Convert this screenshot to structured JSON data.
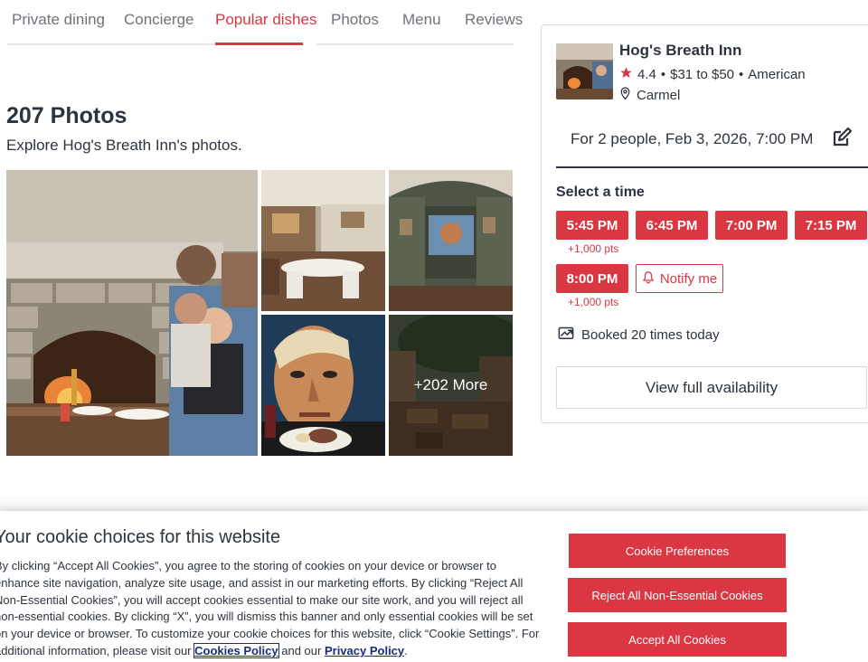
{
  "tabs": [
    {
      "label": "Private dining"
    },
    {
      "label": "Concierge"
    },
    {
      "label": "Popular dishes"
    },
    {
      "label": "Photos"
    },
    {
      "label": "Menu"
    },
    {
      "label": "Reviews"
    }
  ],
  "active_tab": "Popular dishes",
  "photos": {
    "title": "207 Photos",
    "subtitle": "Explore Hog's Breath Inn's photos.",
    "more_label": "+202 More"
  },
  "card": {
    "name": "Hog's Breath Inn",
    "rating": "4.4",
    "price": "$31 to $50",
    "cuisine": "American",
    "separator": "•",
    "location": "Carmel",
    "party": "For 2 people, Feb 3, 2026, 7:00 PM",
    "select_time": "Select a time",
    "slots": [
      "5:45 PM",
      "6:45 PM",
      "7:00 PM",
      "7:15 PM",
      "8:00 PM"
    ],
    "points": [
      "+1,000 pts",
      "+1,000 pts"
    ],
    "notify_label": "Notify me",
    "booked": "Booked 20 times today",
    "view_full": "View full availability"
  },
  "cookie": {
    "title": "Your cookie choices for this website",
    "body": "By clicking “Accept All Cookies”, you agree to the storing of cookies on your device or browser to enhance site navigation, analyze site usage, and assist in our marketing efforts. By clicking “Reject All Non-Essential Cookies”, you will accept cookies essential to make our site work, and you will reject all non-essential cookies. By clicking “X”, you will dismiss this banner and only essential cookies will be set on your device or browser. To customize your cookie choices for this website, click “Cookie Settings”. For additional information, please visit our",
    "policy_link": "Cookies Policy",
    "and_text": "and our",
    "privacy_link": "Privacy Policy",
    "period": ".",
    "btn_preferences": "Cookie Preferences",
    "btn_reject": "Reject All Non-Essential Cookies",
    "btn_accept": "Accept All Cookies"
  },
  "colors": {
    "brand_red": "#da3743",
    "text_dark": "#2d333f",
    "text_muted": "#6f737b",
    "link_blue": "#1a2d78"
  },
  "icons": [
    "star-icon",
    "location-pin-icon",
    "edit-icon",
    "bell-icon",
    "trending-icon"
  ]
}
